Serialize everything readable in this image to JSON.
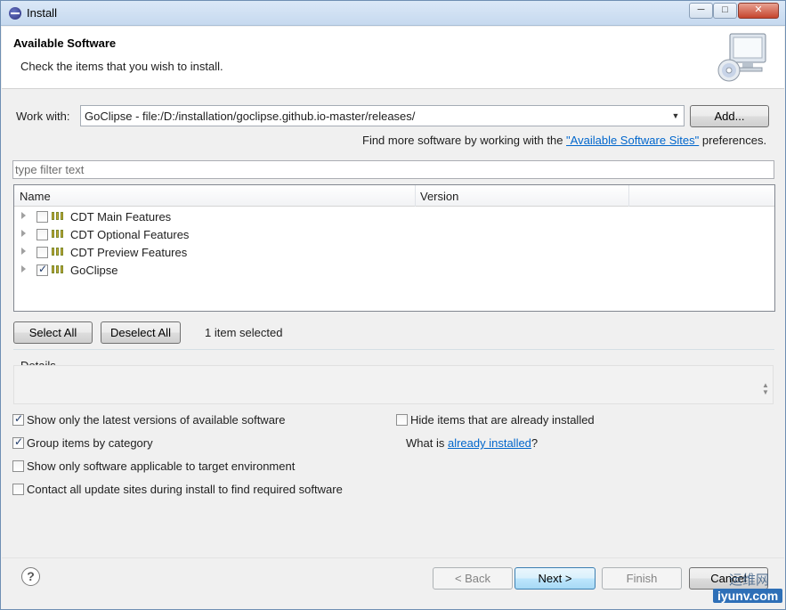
{
  "window": {
    "title": "Install"
  },
  "banner": {
    "title": "Available Software",
    "description": "Check the items that you wish to install."
  },
  "work_with": {
    "label": "Work with:",
    "value": "GoClipse - file:/D:/installation/goclipse.github.io-master/releases/",
    "add_button": "Add..."
  },
  "find_more": {
    "prefix": "Find more software by working with the ",
    "link": "\"Available Software Sites\"",
    "suffix": " preferences."
  },
  "filter": {
    "placeholder": "type filter text"
  },
  "tree": {
    "columns": [
      "Name",
      "Version"
    ],
    "items": [
      {
        "label": "CDT Main Features",
        "checked": false
      },
      {
        "label": "CDT Optional Features",
        "checked": false
      },
      {
        "label": "CDT Preview Features",
        "checked": false
      },
      {
        "label": "GoClipse",
        "checked": true
      }
    ]
  },
  "selection": {
    "select_all": "Select All",
    "deselect_all": "Deselect All",
    "status": "1 item selected"
  },
  "details": {
    "label": "Details"
  },
  "options": {
    "latest_versions": {
      "label": "Show only the latest versions of available software",
      "checked": true
    },
    "hide_installed": {
      "label": "Hide items that are already installed",
      "checked": false
    },
    "group_by_category": {
      "label": "Group items by category",
      "checked": true
    },
    "what_is_prefix": "What is ",
    "what_is_link": "already installed",
    "what_is_suffix": "?",
    "applicable_only": {
      "label": "Show only software applicable to target environment",
      "checked": false
    },
    "contact_sites": {
      "label": "Contact all update sites during install to find required software",
      "checked": false
    }
  },
  "footer": {
    "help": "?",
    "back": "< Back",
    "next": "Next >",
    "finish": "Finish",
    "cancel": "Cancel"
  },
  "watermark": {
    "line1": "运维网",
    "line2": "iyunv.com"
  }
}
